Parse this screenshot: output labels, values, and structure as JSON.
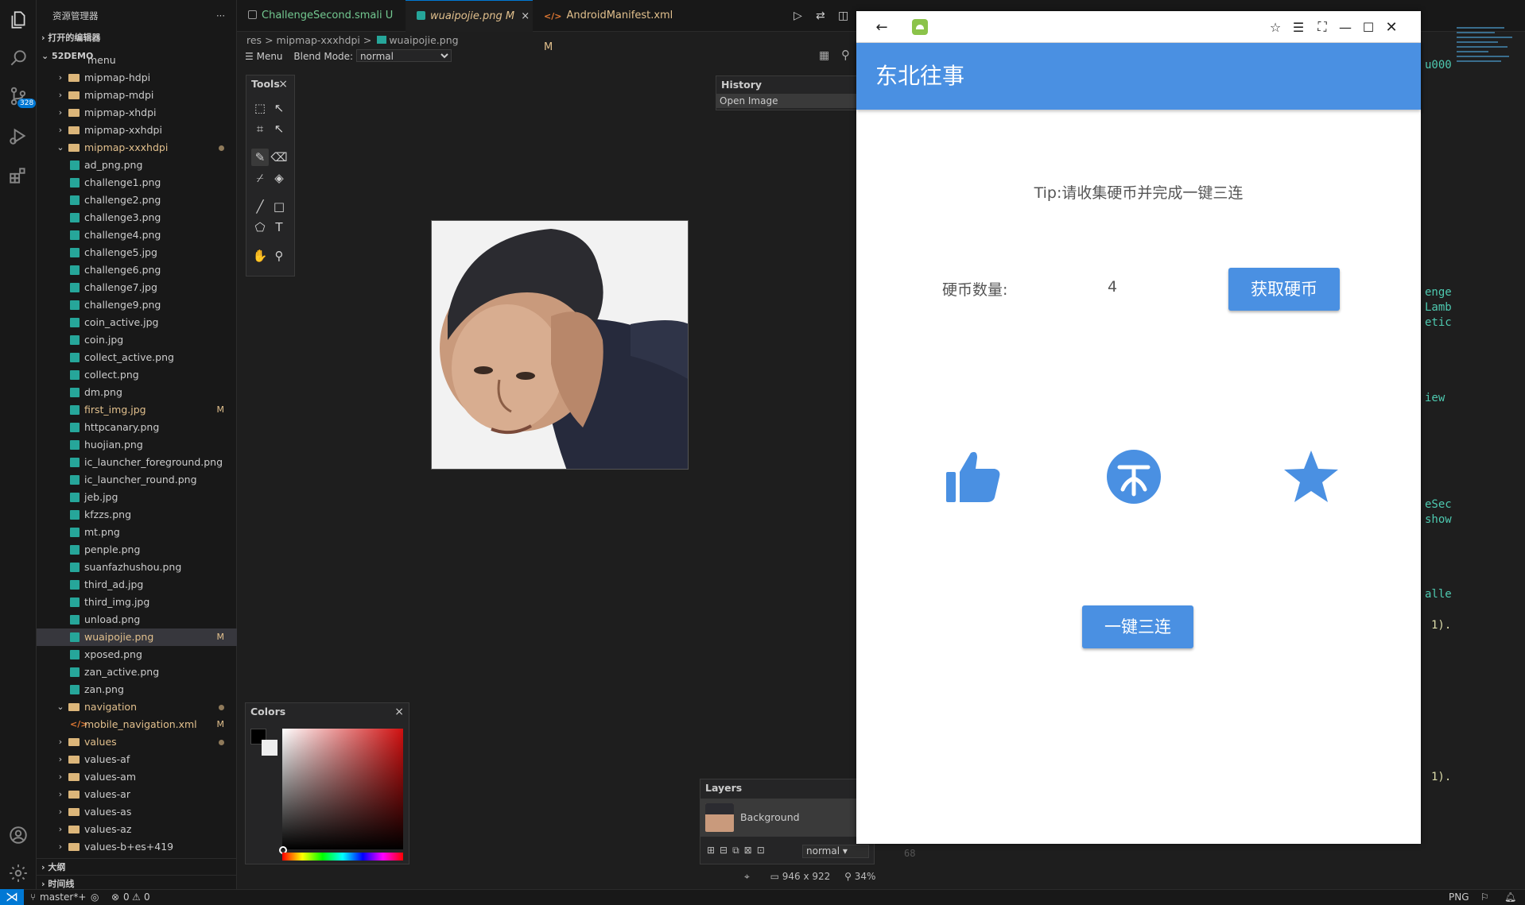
{
  "sidebar": {
    "title": "资源管理器",
    "more": "···",
    "open_editors": "打开的编辑器",
    "project": "52DEMO",
    "clipped_top": "menu",
    "items": [
      {
        "type": "folder",
        "name": "mipmap-hdpi",
        "indent": 1,
        "open": false
      },
      {
        "type": "folder",
        "name": "mipmap-mdpi",
        "indent": 1,
        "open": false
      },
      {
        "type": "folder",
        "name": "mipmap-xhdpi",
        "indent": 1,
        "open": false
      },
      {
        "type": "folder",
        "name": "mipmap-xxhdpi",
        "indent": 1,
        "open": false
      },
      {
        "type": "folder",
        "name": "mipmap-xxxhdpi",
        "indent": 1,
        "open": true,
        "mod": true,
        "dot": true
      },
      {
        "type": "img",
        "name": "ad_png.png",
        "indent": 2
      },
      {
        "type": "img",
        "name": "challenge1.png",
        "indent": 2
      },
      {
        "type": "img",
        "name": "challenge2.png",
        "indent": 2
      },
      {
        "type": "img",
        "name": "challenge3.png",
        "indent": 2
      },
      {
        "type": "img",
        "name": "challenge4.png",
        "indent": 2
      },
      {
        "type": "img",
        "name": "challenge5.jpg",
        "indent": 2
      },
      {
        "type": "img",
        "name": "challenge6.png",
        "indent": 2
      },
      {
        "type": "img",
        "name": "challenge7.jpg",
        "indent": 2
      },
      {
        "type": "img",
        "name": "challenge9.png",
        "indent": 2
      },
      {
        "type": "img",
        "name": "coin_active.jpg",
        "indent": 2
      },
      {
        "type": "img",
        "name": "coin.jpg",
        "indent": 2
      },
      {
        "type": "img",
        "name": "collect_active.png",
        "indent": 2
      },
      {
        "type": "img",
        "name": "collect.png",
        "indent": 2
      },
      {
        "type": "img",
        "name": "dm.png",
        "indent": 2
      },
      {
        "type": "img",
        "name": "first_img.jpg",
        "indent": 2,
        "mod": true,
        "m": "M"
      },
      {
        "type": "img",
        "name": "httpcanary.png",
        "indent": 2
      },
      {
        "type": "img",
        "name": "huojian.png",
        "indent": 2
      },
      {
        "type": "img",
        "name": "ic_launcher_foreground.png",
        "indent": 2
      },
      {
        "type": "img",
        "name": "ic_launcher_round.png",
        "indent": 2
      },
      {
        "type": "img",
        "name": "jeb.jpg",
        "indent": 2
      },
      {
        "type": "img",
        "name": "kfzzs.png",
        "indent": 2
      },
      {
        "type": "img",
        "name": "mt.png",
        "indent": 2
      },
      {
        "type": "img",
        "name": "penple.png",
        "indent": 2
      },
      {
        "type": "img",
        "name": "suanfazhushou.png",
        "indent": 2
      },
      {
        "type": "img",
        "name": "third_ad.jpg",
        "indent": 2
      },
      {
        "type": "img",
        "name": "third_img.jpg",
        "indent": 2
      },
      {
        "type": "img",
        "name": "unload.png",
        "indent": 2
      },
      {
        "type": "img",
        "name": "wuaipojie.png",
        "indent": 2,
        "mod": true,
        "m": "M",
        "sel": true
      },
      {
        "type": "img",
        "name": "xposed.png",
        "indent": 2
      },
      {
        "type": "img",
        "name": "zan_active.png",
        "indent": 2
      },
      {
        "type": "img",
        "name": "zan.png",
        "indent": 2
      },
      {
        "type": "folder",
        "name": "navigation",
        "indent": 1,
        "open": true,
        "mod": true,
        "dot": true
      },
      {
        "type": "xml",
        "name": "mobile_navigation.xml",
        "indent": 2,
        "mod": true,
        "m": "M"
      },
      {
        "type": "folder",
        "name": "values",
        "indent": 1,
        "open": false,
        "mod": true,
        "dot": true
      },
      {
        "type": "folder",
        "name": "values-af",
        "indent": 1,
        "open": false
      },
      {
        "type": "folder",
        "name": "values-am",
        "indent": 1,
        "open": false
      },
      {
        "type": "folder",
        "name": "values-ar",
        "indent": 1,
        "open": false
      },
      {
        "type": "folder",
        "name": "values-as",
        "indent": 1,
        "open": false
      },
      {
        "type": "folder",
        "name": "values-az",
        "indent": 1,
        "open": false
      },
      {
        "type": "folder",
        "name": "values-b+es+419",
        "indent": 1,
        "open": false
      }
    ],
    "outline": "大纲",
    "timeline": "时间线"
  },
  "tabs": [
    {
      "label": "ChallengeSecond.smali",
      "badge": "U",
      "kind": "file",
      "style": "u"
    },
    {
      "label": "wuaipojie.png",
      "badge": "M",
      "kind": "img",
      "style": "m",
      "active": true,
      "close": "×"
    },
    {
      "label": "AndroidManifest.xml",
      "badge": "M",
      "kind": "xml",
      "style": "m"
    }
  ],
  "breadcrumb": [
    "res",
    ">",
    "mipmap-xxxhdpi",
    ">",
    "wuaipojie.png"
  ],
  "editor": {
    "menu_label": "Menu",
    "blend_label": "Blend Mode:",
    "blend_value": "normal",
    "tools_title": "Tools",
    "history_title": "History",
    "history_item": "Open Image",
    "colors_title": "Colors",
    "layers_title": "Layers",
    "layer_name": "Background",
    "layer_blend": "normal",
    "image_size": "946 x 922",
    "zoom": "34%",
    "line_no": "68"
  },
  "code_fragments": [
    "u000",
    "enge",
    "Lamb",
    "etic",
    "iew",
    "eSec",
    "show",
    "alle",
    "1).",
    "1)."
  ],
  "emulator": {
    "app_title": "东北往事",
    "tip": "Tip:请收集硬币并完成一键三连",
    "coin_label": "硬币数量:",
    "coin_count": "4",
    "get_coin_button": "获取硬币",
    "triple_button": "一键三连"
  },
  "statusbar": {
    "branch": "master*+",
    "errors": "0",
    "warnings": "0",
    "lang": "PNG",
    "scm_badge": "328"
  },
  "colors": {
    "accent": "#4a90e2",
    "vscode_blue": "#0078d4"
  }
}
